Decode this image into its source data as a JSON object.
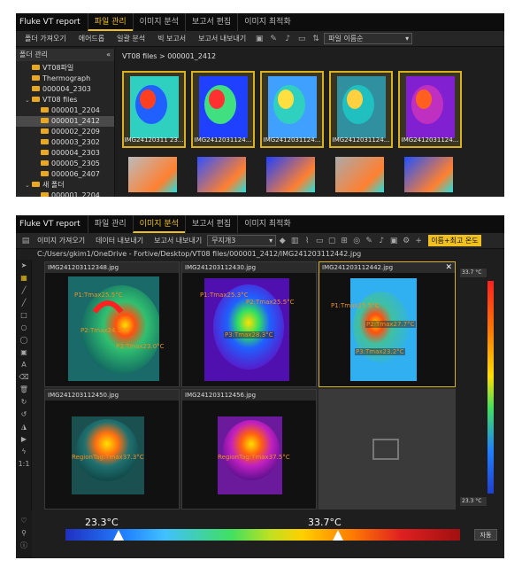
{
  "app": {
    "title": "Fluke VT report"
  },
  "tabs": [
    "파일 관리",
    "이미지 분석",
    "보고서 편집",
    "이미지 최적화"
  ],
  "w1": {
    "toolbar": [
      "폴더 가져오기",
      "에어드롭",
      "일괄 분석",
      "빅 보고서",
      "보고서 내보내기"
    ],
    "sort_select": "파일 이름순",
    "sidebar_title": "폴더 관리",
    "tree": [
      {
        "label": "VT08파일",
        "indent": 1,
        "chev": ""
      },
      {
        "label": "Thermograph",
        "indent": 1,
        "chev": ""
      },
      {
        "label": "000004_2303",
        "indent": 1,
        "chev": ""
      },
      {
        "label": "VT08 files",
        "indent": 1,
        "chev": "v"
      },
      {
        "label": "000001_2204",
        "indent": 2,
        "chev": ""
      },
      {
        "label": "000001_2412",
        "indent": 2,
        "chev": "",
        "selected": true
      },
      {
        "label": "000002_2209",
        "indent": 2,
        "chev": ""
      },
      {
        "label": "000003_2302",
        "indent": 2,
        "chev": ""
      },
      {
        "label": "000004_2303",
        "indent": 2,
        "chev": ""
      },
      {
        "label": "000005_2305",
        "indent": 2,
        "chev": ""
      },
      {
        "label": "000006_2407",
        "indent": 2,
        "chev": ""
      },
      {
        "label": "새 폴더",
        "indent": 1,
        "chev": "v"
      },
      {
        "label": "000001_2204",
        "indent": 2,
        "chev": ""
      }
    ],
    "breadcrumb": "VT08 files > 000001_2412",
    "thumbs": [
      {
        "caption": "IMG24120311 23...",
        "palette": "iron"
      },
      {
        "caption": "IMG2412031124...",
        "palette": "rainbow"
      },
      {
        "caption": "IMG2412031124...",
        "palette": "blue"
      },
      {
        "caption": "IMG2412031124...",
        "palette": "teal"
      },
      {
        "caption": "IMG2412031124...",
        "palette": "purple"
      }
    ]
  },
  "w2": {
    "toolbar": [
      "이미지 가져오기",
      "데이터 내보내기",
      "보고서 내보내기"
    ],
    "palette_select": "무지개3",
    "filter_label": "이름+최고 온도",
    "path": "C:/Users/gkim1/OneDrive - Fortive/Desktop/VT08 files/000001_2412/IMG241203112442.jpg",
    "cells": [
      {
        "title": "IMG241203112348.jpg",
        "labels": [
          "P1:Tmax25.5°C",
          "P2:Tmax24.2°C",
          "P3:Tmax23.0°C"
        ]
      },
      {
        "title": "IMG241203112430.jpg",
        "labels": [
          "P1:Tmax25.3°C",
          "P2:Tmax25.5°C",
          "P3:Tmax28.3°C"
        ]
      },
      {
        "title": "IMG241203112442.jpg",
        "labels": [
          "P1:Tmax25.5°C",
          "P2:Tmax27.7°C",
          "P3:Tmax23.2°C"
        ]
      },
      {
        "title": "IMG241203112450.jpg",
        "labels": [
          "RegionTag:Tmax37.3°C"
        ]
      },
      {
        "title": "IMG241203112456.jpg",
        "labels": [
          "RegionTag:Tmax37.5°C"
        ]
      }
    ],
    "scale_top": "33.7 °C",
    "scale_bottom": "23.3 °C",
    "temp_min": "23.3°C",
    "temp_max": "33.7°C",
    "auto_button": "자동",
    "left_scale_label": "1:1"
  }
}
